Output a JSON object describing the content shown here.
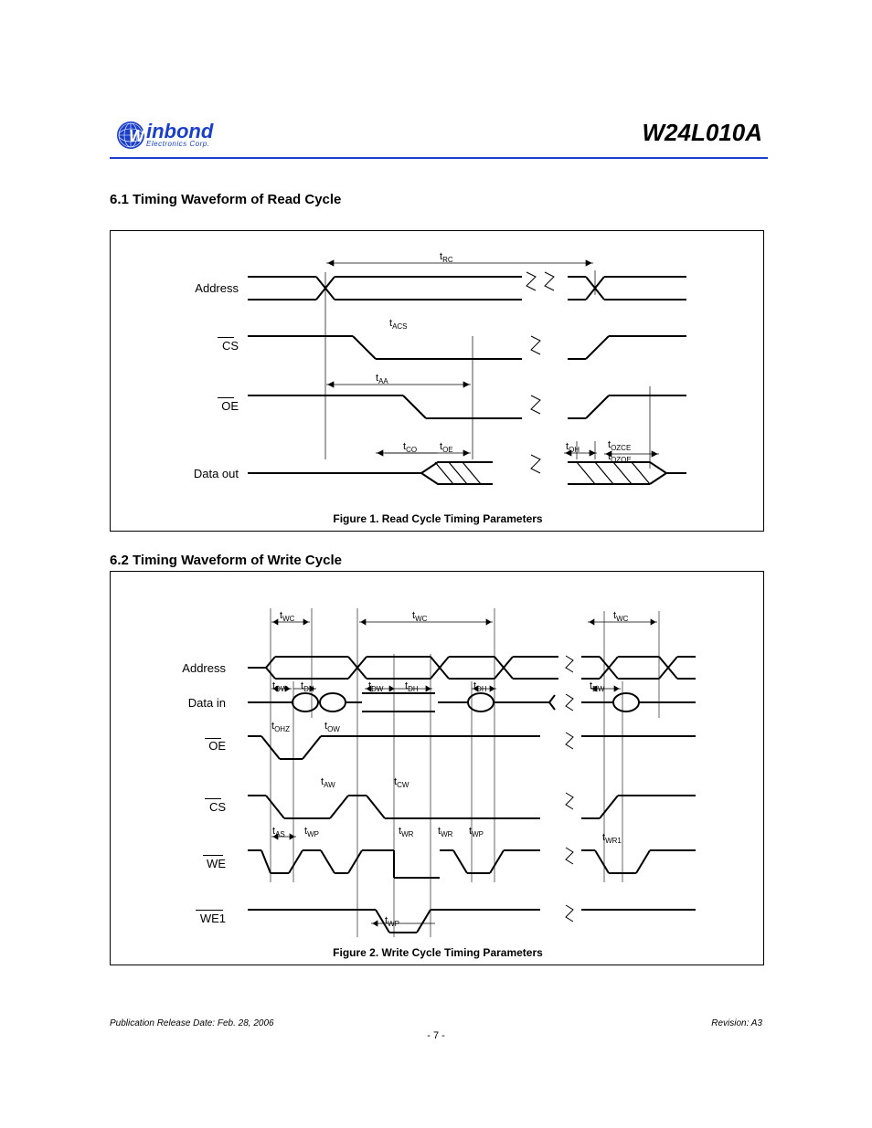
{
  "logo": {
    "main": "inbond",
    "first_letter": "W",
    "sub": "Electronics Corp."
  },
  "part_number": "W24L010A",
  "sections": {
    "one": "6.1 Timing Waveform of Read Cycle",
    "two": "6.2 Timing Waveform of Write Cycle"
  },
  "captions": {
    "fig1": "Figure 1. Read Cycle Timing Parameters",
    "fig2": "Figure 2. Write Cycle Timing Parameters"
  },
  "signals": {
    "read": [
      "Address",
      "CS",
      "OE",
      "Data out"
    ],
    "write": [
      "Address",
      "Data in",
      "OE",
      "CS",
      "WE",
      "WE1"
    ]
  },
  "timings_read": {
    "tRC": "tRC",
    "tCO": "tCO",
    "tOE": "tOE",
    "tAA": "tAA",
    "tOH": "tOH",
    "tACS": "tACS",
    "tOZCE": "tOZCE",
    "tOZOE": "tOZOE"
  },
  "timings_write": {
    "tWC": "tWC",
    "tAW": "tAW",
    "tCW": "tCW",
    "tWR": "tWR",
    "tWP": "tWP",
    "tAS": "tAS",
    "tDW": "tDW",
    "tDH": "tDH",
    "tOHZ": "tOHZ",
    "tOW": "tOW",
    "tWR1": "tWR1"
  },
  "footer": {
    "left": "Publication Release Date: Feb. 28, 2006",
    "center": "- 7 -",
    "right": "Revision: A3",
    "pagenum": ""
  }
}
